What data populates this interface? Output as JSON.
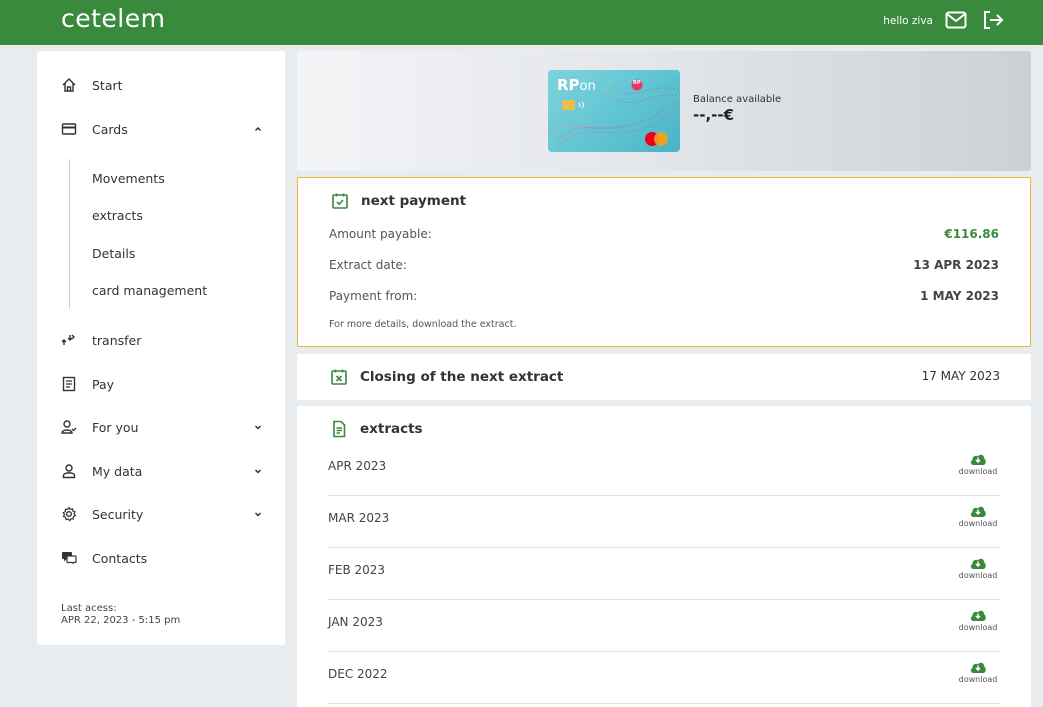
{
  "header": {
    "logo": "cetelem",
    "greeting": "hello ziva",
    "mail_icon": "mail-icon",
    "logout_icon": "logout-icon",
    "brand_color": "#3a8a3d"
  },
  "sidebar": {
    "items": [
      {
        "label": "Start",
        "icon": "home-icon"
      },
      {
        "label": "Cards",
        "icon": "card-icon",
        "expanded": true
      },
      {
        "label": "transfer",
        "icon": "transfer-icon"
      },
      {
        "label": "Pay",
        "icon": "receipt-icon"
      },
      {
        "label": "For you",
        "icon": "user-check-icon"
      },
      {
        "label": "My data",
        "icon": "user-icon"
      },
      {
        "label": "Security",
        "icon": "gear-icon"
      },
      {
        "label": "Contacts",
        "icon": "chat-icon"
      }
    ],
    "card_subitems": [
      "Movements",
      "extracts",
      "Details",
      "card management"
    ],
    "last_access_label": "Last acess:",
    "last_access_value": "APR 22, 2023 - 5:15 pm"
  },
  "card": {
    "brand": "RP",
    "brand_suffix": "on",
    "badge": "RP",
    "balance_label": "Balance available",
    "balance_value": "--,--€"
  },
  "next_payment": {
    "title": "next payment",
    "rows": [
      {
        "label": "Amount payable:",
        "value": "€116.86"
      },
      {
        "label": "Extract date:",
        "value": "13 APR 2023"
      },
      {
        "label": "Payment from:",
        "value": "1 MAY 2023"
      }
    ],
    "note": "For more details, download the extract.",
    "border_color": "#f0b62b"
  },
  "closing": {
    "title": "Closing of the next extract",
    "date": "17 MAY 2023"
  },
  "extracts": {
    "title": "extracts",
    "download_label": "download",
    "rows": [
      "APR 2023",
      "MAR 2023",
      "FEB 2023",
      "JAN 2023",
      "DEC 2022"
    ]
  }
}
